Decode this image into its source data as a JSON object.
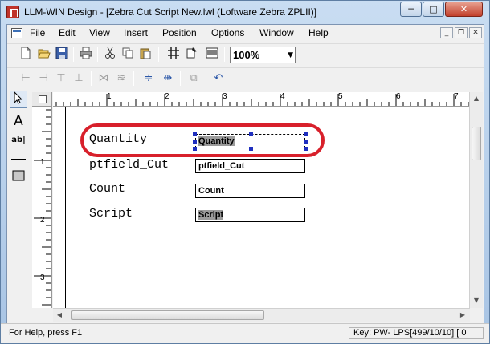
{
  "window": {
    "title": "LLM-WIN Design - [Zebra Cut Script New.lwl (Loftware Zebra ZPLII)]",
    "title_shown": "LLM-WIN Design - [Zebra Cut Script New.lwl (Loftware Zebra ZPLII)]",
    "minimize_glyph": "─",
    "maximize_glyph": "□",
    "close_glyph": "✕"
  },
  "menu": {
    "items": [
      {
        "label": "File"
      },
      {
        "label": "Edit"
      },
      {
        "label": "View"
      },
      {
        "label": "Insert"
      },
      {
        "label": "Position"
      },
      {
        "label": "Options"
      },
      {
        "label": "Window"
      },
      {
        "label": "Help"
      }
    ],
    "mdi_minimize": "_",
    "mdi_restore": "❐",
    "mdi_close": "✕"
  },
  "toolbar": {
    "zoom_value": "100%",
    "icons": [
      "new-icon",
      "open-icon",
      "save-icon",
      "print-icon",
      "cut-icon",
      "copy-icon",
      "paste-icon",
      "grid-icon",
      "properties-icon",
      "barcode-icon"
    ]
  },
  "align_toolbar": {
    "icons": [
      "align-left-icon",
      "align-right-icon",
      "align-top-icon",
      "align-bottom-icon",
      "center-horizontal-icon",
      "center-vertical-icon",
      "space-vertical-icon",
      "space-horizontal-icon",
      "resize-icon",
      "undo-icon"
    ]
  },
  "palette": {
    "tools": [
      "pointer-icon",
      "text-tool-icon",
      "data-field-tool-icon",
      "line-tool-icon",
      "box-tool-icon"
    ],
    "text_glyph": "A",
    "field_glyph": "ab|"
  },
  "ruler": {
    "h_numbers": [
      "1",
      "2",
      "3",
      "4",
      "5",
      "6",
      "7"
    ],
    "v_numbers": [
      "1",
      "2",
      "3"
    ]
  },
  "label": {
    "fields": [
      {
        "name": "Quantity",
        "value": "Quantity",
        "selected": true,
        "highlighted": true
      },
      {
        "name": "ptfield_Cut",
        "value": "ptfield_Cut",
        "selected": false,
        "highlighted": false
      },
      {
        "name": "Count",
        "value": "Count",
        "selected": false,
        "highlighted": false
      },
      {
        "name": "Script",
        "value": "Script",
        "selected": false,
        "highlighted": true
      }
    ]
  },
  "status": {
    "left": "For Help, press F1",
    "right": "Key: PW- LPS[499/10/10] [ 0"
  },
  "colors": {
    "annotation": "#d8202b",
    "selection_handle": "#1f2fbf",
    "field_highlight": "#9b9b9b"
  }
}
